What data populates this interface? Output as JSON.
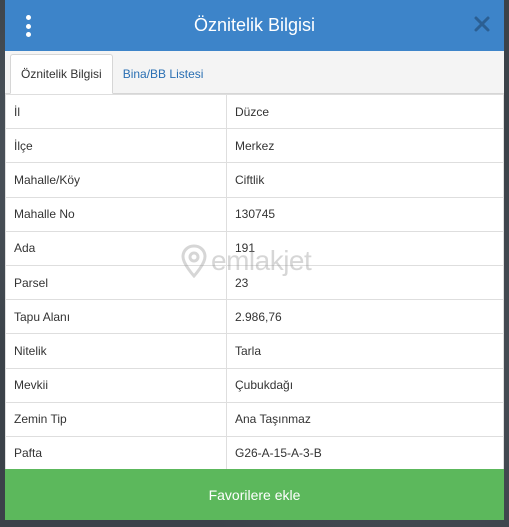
{
  "header": {
    "title": "Öznitelik Bilgisi"
  },
  "tabs": [
    {
      "label": "Öznitelik Bilgisi",
      "active": true
    },
    {
      "label": "Bina/BB Listesi",
      "active": false
    }
  ],
  "attributes": [
    {
      "key": "İl",
      "value": "Düzce"
    },
    {
      "key": "İlçe",
      "value": "Merkez"
    },
    {
      "key": "Mahalle/Köy",
      "value": "Ciftlik"
    },
    {
      "key": "Mahalle No",
      "value": "130745"
    },
    {
      "key": "Ada",
      "value": "191"
    },
    {
      "key": "Parsel",
      "value": "23"
    },
    {
      "key": "Tapu Alanı",
      "value": "2.986,76"
    },
    {
      "key": "Nitelik",
      "value": "Tarla"
    },
    {
      "key": "Mevkii",
      "value": "Çubukdağı"
    },
    {
      "key": "Zemin Tip",
      "value": "Ana Taşınmaz"
    },
    {
      "key": "Pafta",
      "value": "G26-A-15-A-3-B"
    }
  ],
  "watermark": {
    "text": "emlakjet"
  },
  "footer": {
    "button_label": "Favorilere ekle"
  },
  "colors": {
    "header": "#3d84c9",
    "footer": "#5cb85c",
    "tab_link": "#2a6fb3"
  },
  "icons": {
    "menu": "vertical-dots-icon",
    "close": "close-icon",
    "watermark": "location-pin-icon"
  }
}
